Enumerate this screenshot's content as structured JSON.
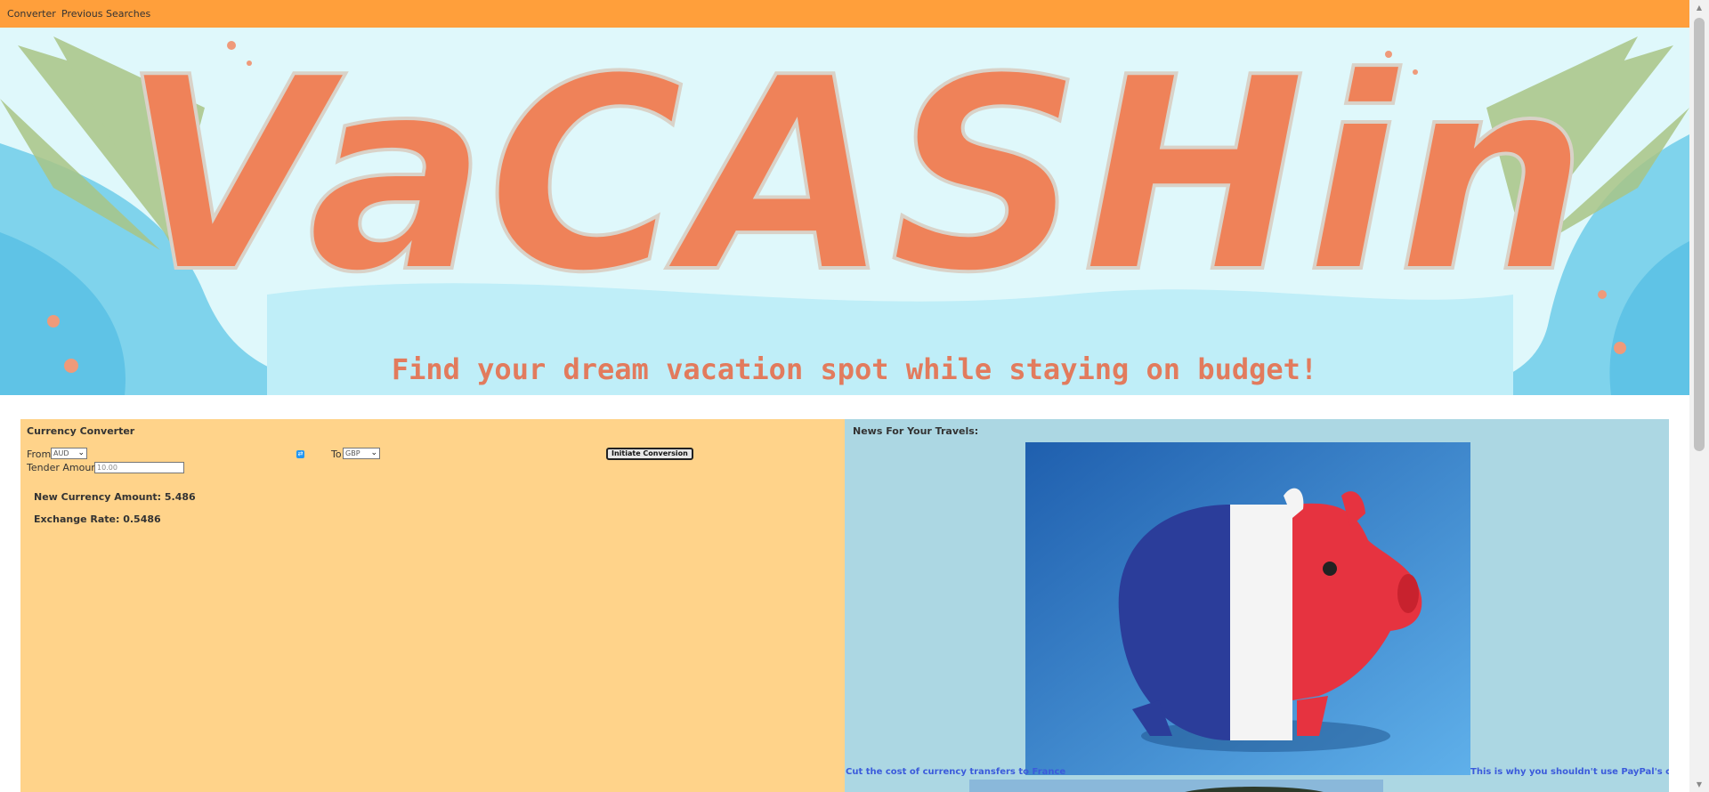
{
  "nav": {
    "converter": "Converter",
    "previous_searches": "Previous Searches"
  },
  "banner": {
    "logo_text": "VaCASHin",
    "tagline": "Find your dream vacation spot while staying on budget!",
    "colors": {
      "sky": "#aeeaf6",
      "logo": "#ef8259",
      "water": "#7fd3ec"
    }
  },
  "converter": {
    "title": "Currency Converter",
    "from_label": "From",
    "from_value": "AUD",
    "swap_icon": "swap-icon",
    "to_label": "To",
    "to_value": "GBP",
    "button_label": "Initiate Conversion",
    "tender_label": "Tender Amount",
    "tender_value": "10.00",
    "new_amount": "New Currency Amount: 5.486",
    "exchange_rate": "Exchange Rate: 0.5486"
  },
  "news": {
    "title": "News For Your Travels:",
    "article1": "Cut the cost of currency transfers to France",
    "article2": "This is why you shouldn't use PayPal's currency",
    "image1": "french-flag-piggy-bank-image"
  },
  "colors": {
    "nav_bg": "#ff9f3b",
    "converter_bg": "#ffd38a",
    "news_bg": "#acd7e3",
    "link": "#3b5bdb"
  }
}
